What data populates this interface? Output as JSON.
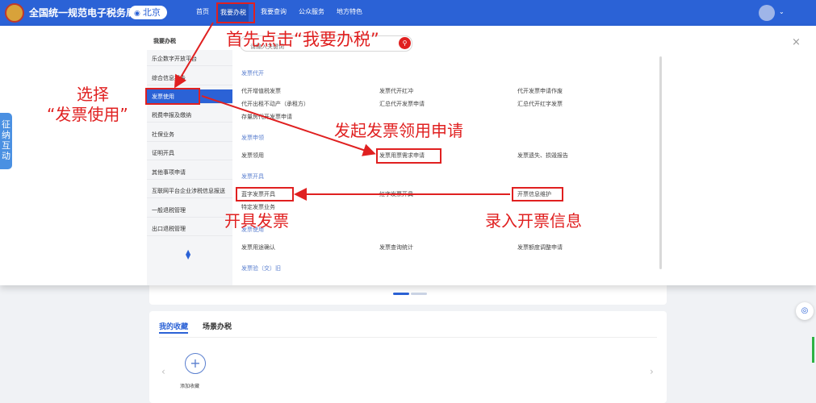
{
  "header": {
    "site_title": "全国统一规范电子税务局",
    "city": "北京",
    "nav": [
      "首页",
      "我要办税",
      "我要查询",
      "公众服务",
      "地方特色"
    ]
  },
  "side_tab": {
    "label": "征纳互动"
  },
  "menu": {
    "title": "我要办税",
    "items": [
      "乐企数字开放平台",
      "综合信息报告",
      "发票使用",
      "税费申报及缴纳",
      "社保业务",
      "证明开具",
      "其他事项申请",
      "互联网平台企业涉税信息报送",
      "一般退税管理",
      "出口退税管理"
    ]
  },
  "search": {
    "placeholder": "请输入关键词",
    "icon": "search-icon"
  },
  "sections": [
    {
      "title": "发票代开",
      "rows": [
        [
          "代开增值税发票",
          "发票代开红冲",
          "代开发票申请作废"
        ],
        [
          "代开出租不动产（承租方）",
          "汇总代开发票申请",
          "汇总代开红字发票"
        ],
        [
          "存量房代开发票申请"
        ]
      ]
    },
    {
      "title": "发票申领",
      "rows": [
        [
          "发票领用",
          "发票用票需求申请",
          "发票遗失、损毁报告"
        ]
      ]
    },
    {
      "title": "发票开具",
      "rows": [
        [
          "蓝字发票开具",
          "红字发票开具",
          "开票信息维护"
        ],
        [
          "特定发票业务"
        ]
      ]
    },
    {
      "title": "发票使用",
      "rows": [
        [
          "发票用途确认",
          "发票查询统计",
          "发票额度调整申请"
        ]
      ]
    },
    {
      "title": "发票验（交）旧",
      "rows": []
    }
  ],
  "annotations": {
    "step1": "首先点击“我要办税”",
    "step2_line1": "选择",
    "step2_line2": "“发票使用”",
    "step3": "发起发票领用申请",
    "step4": "开具发票",
    "step5": "录入开票信息",
    "color": "#e02020"
  },
  "favorites": {
    "tabs": [
      "我的收藏",
      "场景办税"
    ],
    "add_label": "添加收藏"
  },
  "colors": {
    "brand": "#2b62d6",
    "annotation": "#e02020"
  }
}
